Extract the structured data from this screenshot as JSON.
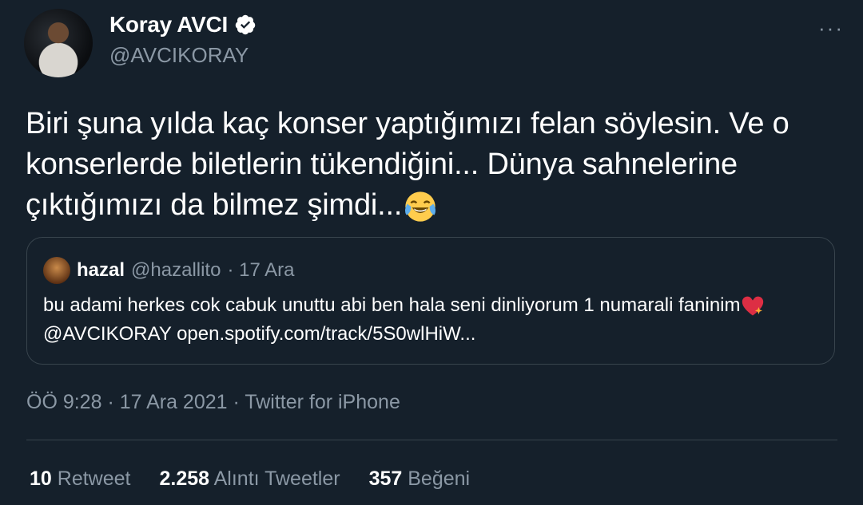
{
  "author": {
    "name": "Koray AVCI",
    "handle": "@AVCIKORAY"
  },
  "more_label": "···",
  "tweet": {
    "text": "Biri şuna yılda kaç konser yaptığımızı felan söylesin. Ve o konserlerde biletlerin tükendiğini... Dünya sahnelerine çıktığımızı da bilmez şimdi...",
    "emoji": "face-with-tears-of-joy"
  },
  "quoted": {
    "name": "hazal",
    "handle": "@hazallito",
    "date": "· 17 Ara",
    "text": "bu adami herkes cok cabuk unuttu abi ben hala seni dinliyorum 1 numarali faninim",
    "emoji": "sparkling-heart",
    "mention": "@AVCIKORAY",
    "link": "open.spotify.com/track/5S0wlHiW..."
  },
  "timestamp": "ÖÖ 9:28 · 17 Ara 2021 · Twitter for iPhone",
  "stats": {
    "retweets_count": "10",
    "retweets_label": "Retweet",
    "quotes_count": "2.258",
    "quotes_label": "Alıntı Tweetler",
    "likes_count": "357",
    "likes_label": "Beğeni"
  },
  "colors": {
    "background": "#15202b",
    "secondary_text": "#8b98a5",
    "border": "#38444d"
  }
}
